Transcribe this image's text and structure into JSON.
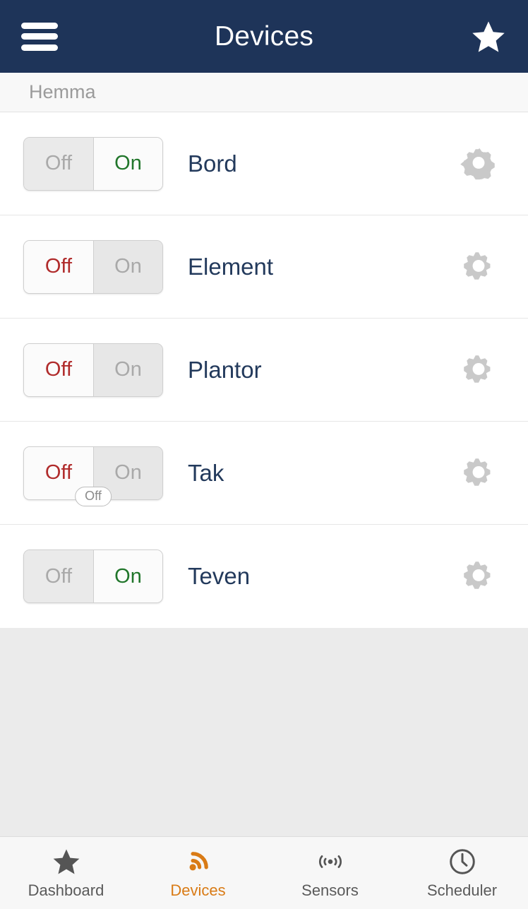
{
  "header": {
    "title": "Devices",
    "menu_icon": "hamburger-menu-icon",
    "favorite_icon": "star-icon",
    "background_color": "#1e3459"
  },
  "section": {
    "label": "Hemma"
  },
  "toggle_labels": {
    "off": "Off",
    "on": "On"
  },
  "colors": {
    "on_text": "#21762b",
    "off_text": "#b02b2b",
    "inactive_text": "#a9a9a9",
    "device_name": "#233a5c",
    "accent": "#d97b16"
  },
  "devices": [
    {
      "name": "Bord",
      "state": "on",
      "settings_icon": "gear-icon",
      "tooltip": null
    },
    {
      "name": "Element",
      "state": "off",
      "settings_icon": "gear-icon",
      "tooltip": null
    },
    {
      "name": "Plantor",
      "state": "off",
      "settings_icon": "gear-icon",
      "tooltip": null
    },
    {
      "name": "Tak",
      "state": "off",
      "settings_icon": "gear-icon",
      "tooltip": "Off"
    },
    {
      "name": "Teven",
      "state": "on",
      "settings_icon": "gear-icon",
      "tooltip": null
    }
  ],
  "bottom_nav": {
    "items": [
      {
        "label": "Dashboard",
        "icon": "star-icon",
        "active": false
      },
      {
        "label": "Devices",
        "icon": "signal-icon",
        "active": true
      },
      {
        "label": "Sensors",
        "icon": "sensor-icon",
        "active": false
      },
      {
        "label": "Scheduler",
        "icon": "clock-icon",
        "active": false
      }
    ]
  }
}
